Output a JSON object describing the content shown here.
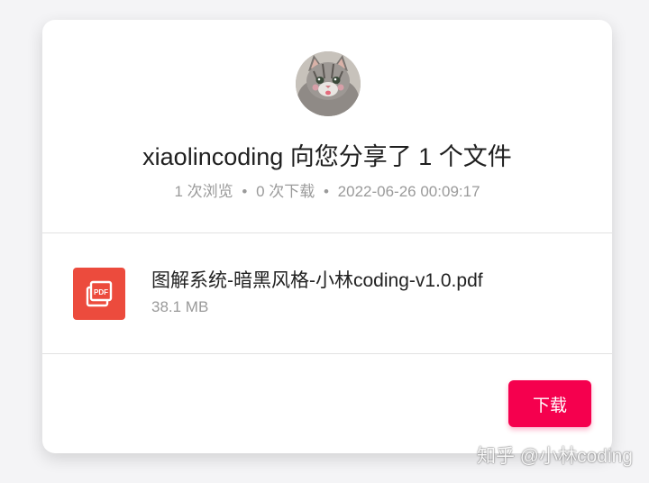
{
  "share": {
    "sharer": "xiaolincoding",
    "title": "xiaolincoding 向您分享了 1 个文件",
    "views": "1 次浏览",
    "downloads": "0 次下载",
    "timestamp": "2022-06-26 00:09:17",
    "separator": "•"
  },
  "file": {
    "icon": "pdf-file-icon",
    "icon_label": "PDF",
    "name": "图解系统-暗黑风格-小林coding-v1.0.pdf",
    "size": "38.1 MB"
  },
  "actions": {
    "download_label": "下载"
  },
  "watermark": {
    "text": "知乎 @小林coding"
  },
  "colors": {
    "accent": "#f5004e",
    "pdf_icon": "#ec4b3d",
    "muted_text": "#9a9a9a"
  }
}
